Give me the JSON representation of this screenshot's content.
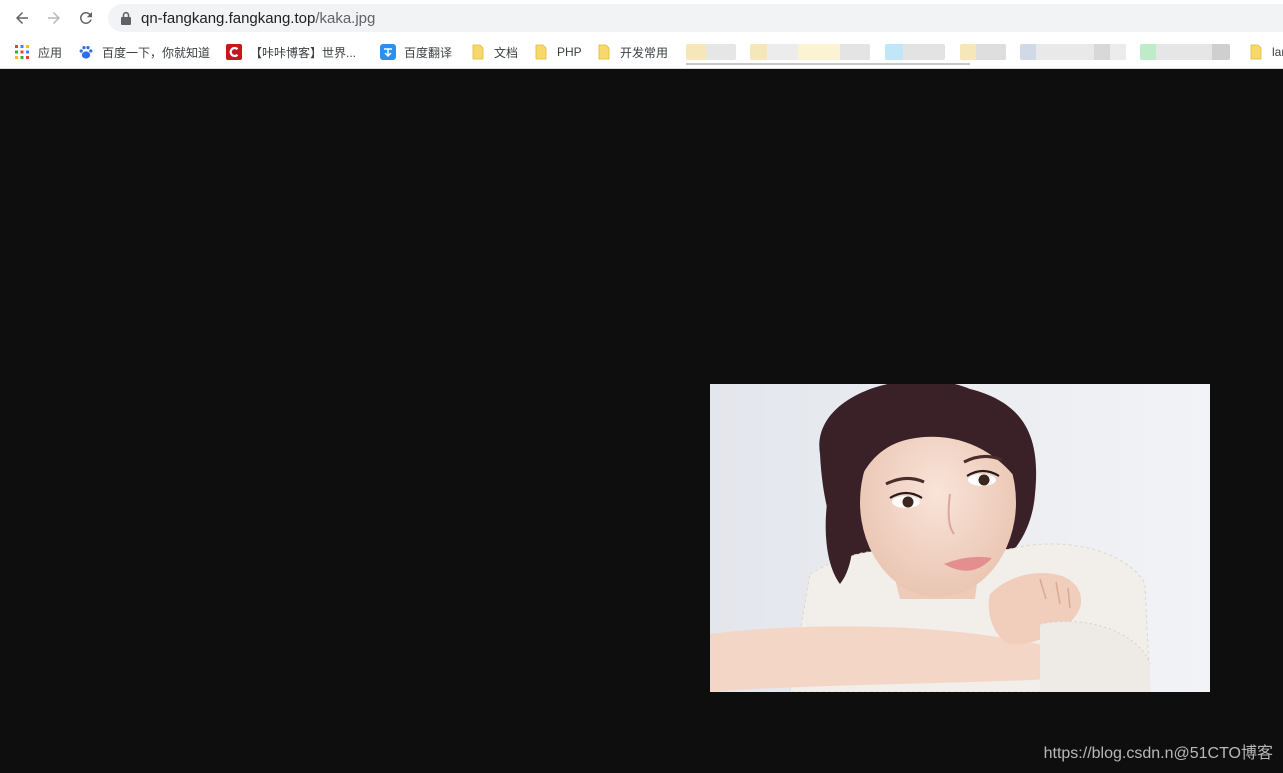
{
  "address_bar": {
    "host": "qn-fangkang.fangkang.top",
    "path": "/kaka.jpg"
  },
  "icons": {
    "back": "arrow-left-icon",
    "forward": "arrow-right-icon",
    "reload": "reload-icon",
    "secure": "lock-icon"
  },
  "bookmarks": [
    {
      "label": "应用",
      "icon": "apps-grid-icon"
    },
    {
      "label": "百度一下，你就知道",
      "icon": "baidu-paw-icon"
    },
    {
      "label": "【咔咔博客】世界...",
      "icon": "c-logo-icon"
    },
    {
      "label": "百度翻译",
      "icon": "translate-icon"
    },
    {
      "label": "文档",
      "icon": "folder-icon"
    },
    {
      "label": "PHP",
      "icon": "folder-icon"
    },
    {
      "label": "开发常用",
      "icon": "folder-icon"
    },
    {
      "label": "lar",
      "icon": "folder-icon"
    }
  ],
  "watermark": "https://blog.csdn.n@51CTO博客",
  "colors": {
    "page_background": "#0e0e0e",
    "folder": "#f7d96b",
    "c_logo": "#c8161d",
    "translate": "#2b8ff0"
  }
}
